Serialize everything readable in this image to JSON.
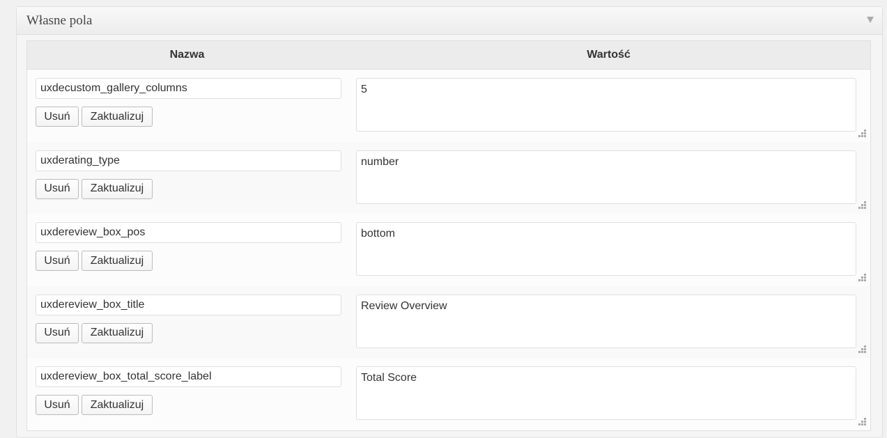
{
  "metabox": {
    "title": "Własne pola"
  },
  "table": {
    "headers": {
      "name": "Nazwa",
      "value": "Wartość"
    },
    "delete_label": "Usuń",
    "update_label": "Zaktualizuj",
    "rows": [
      {
        "key": "uxdecustom_gallery_columns",
        "value": "5"
      },
      {
        "key": "uxderating_type",
        "value": "number"
      },
      {
        "key": "uxdereview_box_pos",
        "value": "bottom"
      },
      {
        "key": "uxdereview_box_title",
        "value": "Review Overview"
      },
      {
        "key": "uxdereview_box_total_score_label",
        "value": "Total Score"
      }
    ]
  }
}
